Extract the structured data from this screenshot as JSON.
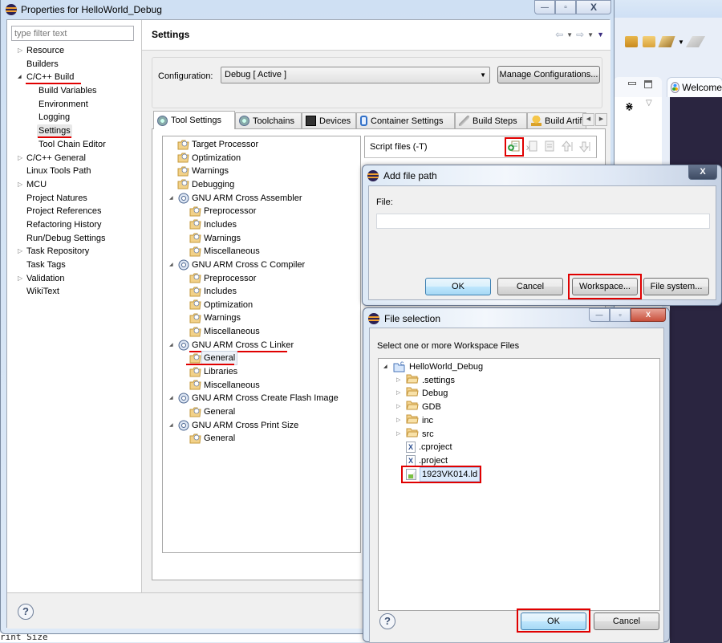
{
  "background": {
    "welcome_tab": "Welcome",
    "console_fragment": "rint Size"
  },
  "window": {
    "title": "Properties for HelloWorld_Debug",
    "controls": {
      "minimize": "—",
      "maximize": "▫",
      "close": "X"
    }
  },
  "left_nav": {
    "filter_placeholder": "type filter text",
    "items": [
      {
        "label": "Resource",
        "expandable": true,
        "expanded": false,
        "level": 0
      },
      {
        "label": "Builders",
        "expandable": false,
        "level": 0
      },
      {
        "label": "C/C++ Build",
        "expandable": true,
        "expanded": true,
        "level": 0,
        "highlighted": true
      },
      {
        "label": "Build Variables",
        "level": 1
      },
      {
        "label": "Environment",
        "level": 1
      },
      {
        "label": "Logging",
        "level": 1
      },
      {
        "label": "Settings",
        "level": 1,
        "selected": true,
        "highlighted": true
      },
      {
        "label": "Tool Chain Editor",
        "level": 1
      },
      {
        "label": "C/C++ General",
        "expandable": true,
        "expanded": false,
        "level": 0
      },
      {
        "label": "Linux Tools Path",
        "level": 0
      },
      {
        "label": "MCU",
        "expandable": true,
        "expanded": false,
        "level": 0
      },
      {
        "label": "Project Natures",
        "level": 0
      },
      {
        "label": "Project References",
        "level": 0
      },
      {
        "label": "Refactoring History",
        "level": 0
      },
      {
        "label": "Run/Debug Settings",
        "level": 0
      },
      {
        "label": "Task Repository",
        "expandable": true,
        "expanded": false,
        "level": 0
      },
      {
        "label": "Task Tags",
        "level": 0
      },
      {
        "label": "Validation",
        "expandable": true,
        "expanded": false,
        "level": 0
      },
      {
        "label": "WikiText",
        "level": 0
      }
    ]
  },
  "settings": {
    "title": "Settings",
    "configuration_label": "Configuration:",
    "configuration_value": "Debug  [ Active ]",
    "manage_button": "Manage Configurations...",
    "tabs": [
      {
        "label": "Tool Settings",
        "icon": "tool-settings-icon",
        "active": true
      },
      {
        "label": "Toolchains",
        "icon": "toolchains-icon"
      },
      {
        "label": "Devices",
        "icon": "devices-icon"
      },
      {
        "label": "Container Settings",
        "icon": "container-icon"
      },
      {
        "label": "Build Steps",
        "icon": "build-steps-icon"
      },
      {
        "label": "Build Artifa",
        "icon": "trophy-icon"
      }
    ],
    "tool_tree": [
      {
        "label": "Target Processor",
        "level": 1,
        "type": "option"
      },
      {
        "label": "Optimization",
        "level": 1,
        "type": "option"
      },
      {
        "label": "Warnings",
        "level": 1,
        "type": "option"
      },
      {
        "label": "Debugging",
        "level": 1,
        "type": "option"
      },
      {
        "label": "GNU ARM Cross Assembler",
        "level": 0,
        "type": "tool"
      },
      {
        "label": "Preprocessor",
        "level": 2,
        "type": "option"
      },
      {
        "label": "Includes",
        "level": 2,
        "type": "option"
      },
      {
        "label": "Warnings",
        "level": 2,
        "type": "option"
      },
      {
        "label": "Miscellaneous",
        "level": 2,
        "type": "option"
      },
      {
        "label": "GNU ARM Cross C Compiler",
        "level": 0,
        "type": "tool"
      },
      {
        "label": "Preprocessor",
        "level": 2,
        "type": "option"
      },
      {
        "label": "Includes",
        "level": 2,
        "type": "option"
      },
      {
        "label": "Optimization",
        "level": 2,
        "type": "option"
      },
      {
        "label": "Warnings",
        "level": 2,
        "type": "option"
      },
      {
        "label": "Miscellaneous",
        "level": 2,
        "type": "option"
      },
      {
        "label": "GNU ARM Cross C Linker",
        "level": 0,
        "type": "tool",
        "highlighted": true
      },
      {
        "label": "General",
        "level": 2,
        "type": "option",
        "selected": true,
        "highlighted": true
      },
      {
        "label": "Libraries",
        "level": 2,
        "type": "option"
      },
      {
        "label": "Miscellaneous",
        "level": 2,
        "type": "option"
      },
      {
        "label": "GNU ARM Cross Create Flash Image",
        "level": 0,
        "type": "tool"
      },
      {
        "label": "General",
        "level": 2,
        "type": "option"
      },
      {
        "label": "GNU ARM Cross Print Size",
        "level": 0,
        "type": "tool"
      },
      {
        "label": "General",
        "level": 2,
        "type": "option"
      }
    ],
    "script_files_label": "Script files (-T)",
    "script_tools": [
      "add-icon",
      "delete-icon",
      "edit-icon",
      "move-up-icon",
      "move-down-icon"
    ]
  },
  "add_file_dialog": {
    "title": "Add file path",
    "close": "X",
    "file_label": "File:",
    "file_value": "",
    "buttons": {
      "ok": "OK",
      "cancel": "Cancel",
      "workspace": "Workspace...",
      "file_system": "File system..."
    }
  },
  "file_selection_dialog": {
    "title": "File selection",
    "prompt": "Select one or more Workspace Files",
    "tree": [
      {
        "label": "HelloWorld_Debug",
        "type": "project",
        "level": 0,
        "expanded": true
      },
      {
        "label": ".settings",
        "type": "folder",
        "level": 1
      },
      {
        "label": "Debug",
        "type": "folder",
        "level": 1
      },
      {
        "label": "GDB",
        "type": "folder",
        "level": 1
      },
      {
        "label": "inc",
        "type": "folder",
        "level": 1
      },
      {
        "label": "src",
        "type": "folder",
        "level": 1
      },
      {
        "label": ".cproject",
        "type": "xml",
        "level": 1
      },
      {
        "label": ".project",
        "type": "xml",
        "level": 1
      },
      {
        "label": "1923VK014.ld",
        "type": "ld",
        "level": 1,
        "selected": true
      }
    ],
    "buttons": {
      "ok": "OK",
      "cancel": "Cancel"
    },
    "controls": {
      "minimize": "—",
      "maximize": "▫",
      "close": "X"
    }
  },
  "colors": {
    "annotation_red": "#e00000",
    "welcome_bg": "#2a2540"
  }
}
